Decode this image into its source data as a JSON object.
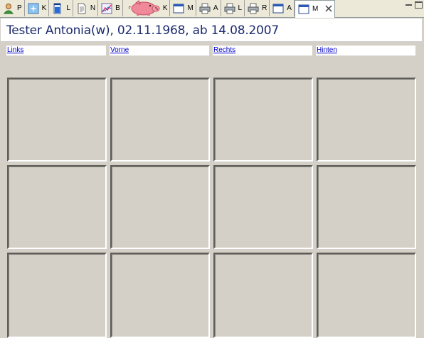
{
  "tabs": [
    {
      "label": "P",
      "icon": "person-icon",
      "active": false
    },
    {
      "label": "K",
      "icon": "sparkle-image-icon",
      "active": false
    },
    {
      "label": "L",
      "icon": "lab-flask-icon",
      "active": false
    },
    {
      "label": "N",
      "icon": "note-document-icon",
      "active": false
    },
    {
      "label": "B",
      "icon": "chart-image-icon",
      "active": false
    },
    {
      "label": "K",
      "icon": "piggy-bank-icon",
      "active": false
    },
    {
      "label": "M",
      "icon": "window-icon",
      "active": false
    },
    {
      "label": "A",
      "icon": "printer-icon",
      "active": false
    },
    {
      "label": "L",
      "icon": "printer-icon",
      "active": false
    },
    {
      "label": "R",
      "icon": "printer-icon",
      "active": false
    },
    {
      "label": "A",
      "icon": "window-icon",
      "active": false
    },
    {
      "label": "M",
      "icon": "window-icon",
      "active": true,
      "closable": true
    }
  ],
  "window_controls": {
    "minimize": "minimize-icon",
    "maximize": "maximize-icon"
  },
  "patient": {
    "title": "Tester Antonia(w), 02.11.1968, ab 14.08.2007"
  },
  "columns": [
    "Links",
    "Vorne",
    "Rechts",
    "Hinten"
  ],
  "rows": 3,
  "colors": {
    "title": "#1c2a6c",
    "link": "#0000cc",
    "panel": "#d4d0c8"
  }
}
